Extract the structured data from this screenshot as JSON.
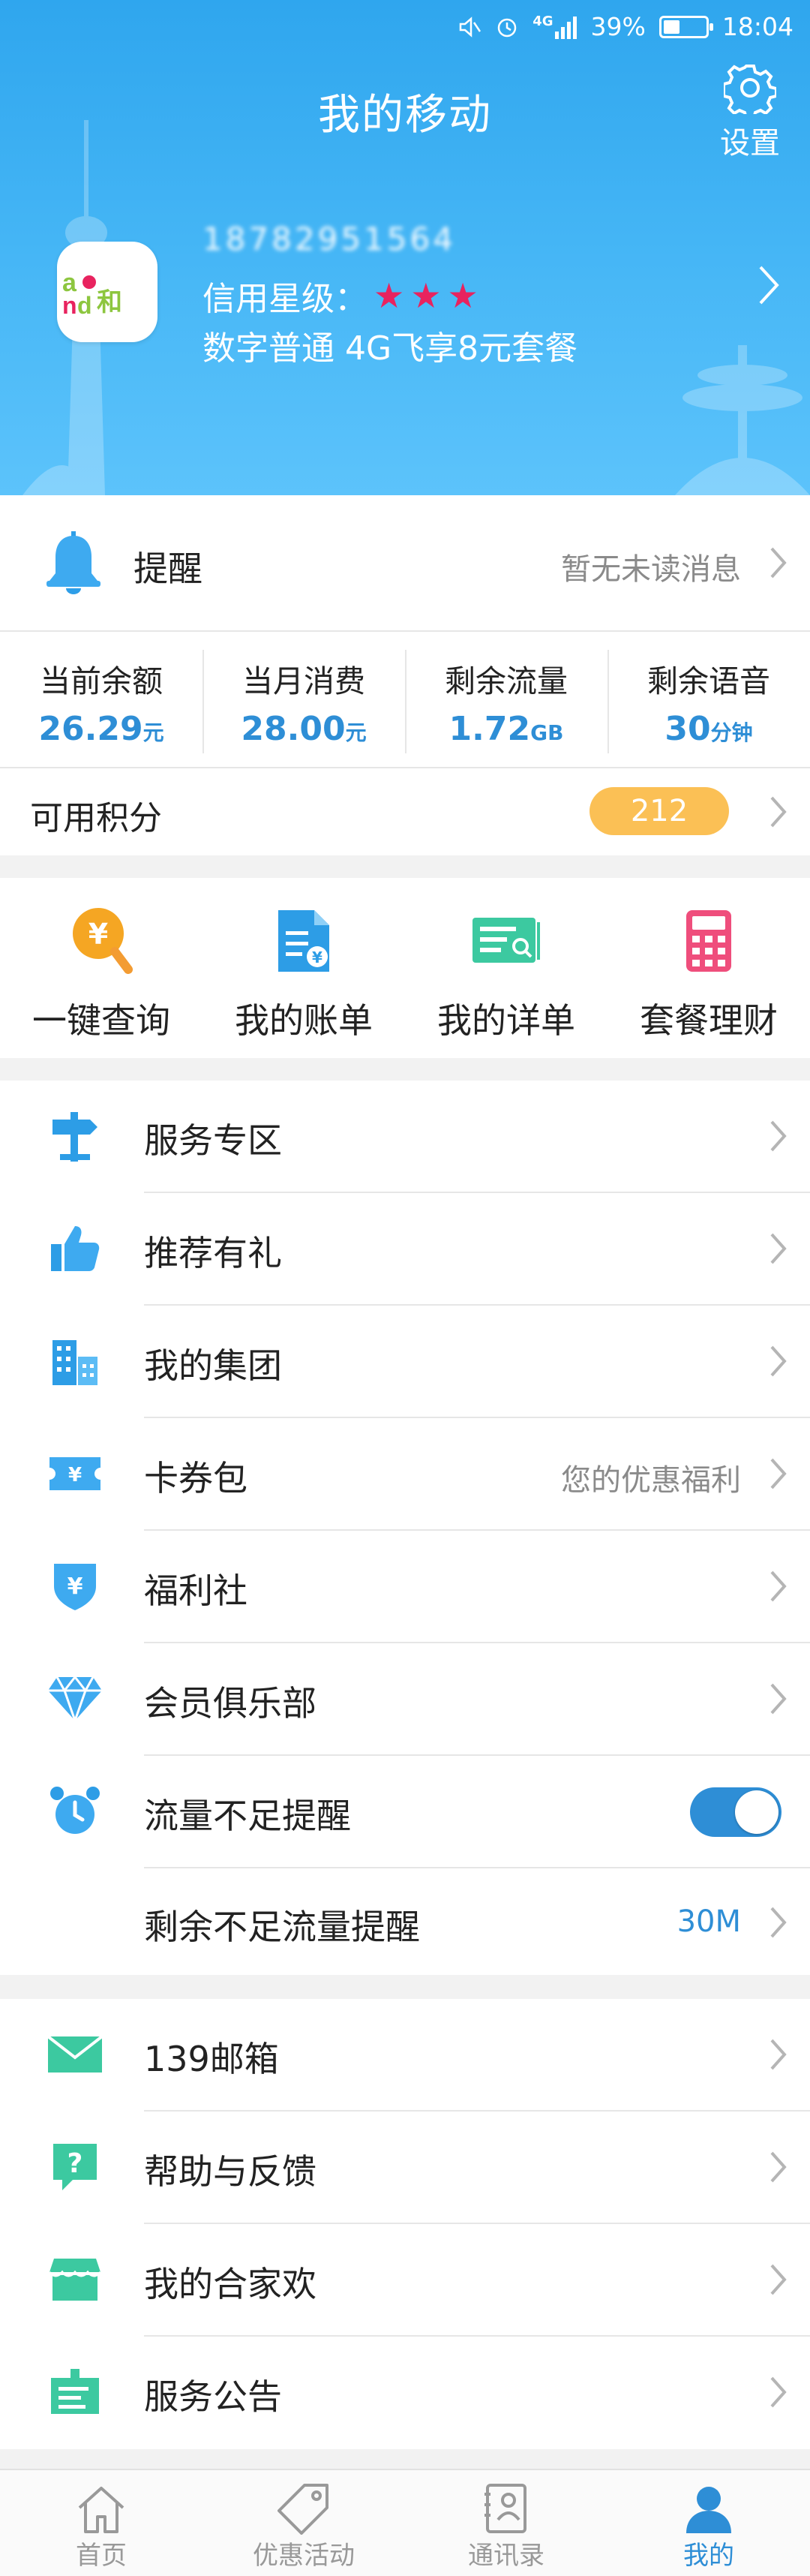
{
  "status_bar": {
    "battery": "39%",
    "time": "18:04",
    "network": "4G",
    "battery_level": 0.39
  },
  "header": {
    "title": "我的移动",
    "settings_label": "设置"
  },
  "profile": {
    "phone": "18782951564",
    "credit_label": "信用星级：",
    "credit_stars": 3,
    "star_glyph": "★",
    "plan": "数字普通  4G飞享8元套餐",
    "logo_text": "and和"
  },
  "reminder": {
    "label": "提醒",
    "status": "暂无未读消息"
  },
  "stats": [
    {
      "label": "当前余额",
      "value": "26.29",
      "unit": "元"
    },
    {
      "label": "当月消费",
      "value": "28.00",
      "unit": "元"
    },
    {
      "label": "剩余流量",
      "value": "1.72",
      "unit": "GB"
    },
    {
      "label": "剩余语音",
      "value": "30",
      "unit": "分钟"
    }
  ],
  "points": {
    "label": "可用积分",
    "value": "212"
  },
  "quick": [
    {
      "label": "一键查询",
      "icon": "coin-search-icon"
    },
    {
      "label": "我的账单",
      "icon": "bill-icon"
    },
    {
      "label": "我的详单",
      "icon": "detail-list-icon"
    },
    {
      "label": "套餐理财",
      "icon": "calculator-icon"
    }
  ],
  "menu1": [
    {
      "label": "服务专区",
      "sub": "",
      "icon": "signpost-icon"
    },
    {
      "label": "推荐有礼",
      "sub": "",
      "icon": "thumbs-up-icon"
    },
    {
      "label": "我的集团",
      "sub": "",
      "icon": "building-icon"
    },
    {
      "label": "卡券包",
      "sub": "您的优惠福利",
      "icon": "ticket-icon"
    },
    {
      "label": "福利社",
      "sub": "",
      "icon": "welfare-shield-icon"
    },
    {
      "label": "会员俱乐部",
      "sub": "",
      "icon": "diamond-icon"
    },
    {
      "label": "流量不足提醒",
      "sub": "",
      "icon": "alarm-clock-icon",
      "toggle": true
    },
    {
      "label": "剩余不足流量提醒",
      "sub": "30M",
      "icon": ""
    }
  ],
  "menu2": [
    {
      "label": "139邮箱",
      "icon": "mail-icon"
    },
    {
      "label": "帮助与反馈",
      "icon": "help-icon"
    },
    {
      "label": "我的合家欢",
      "icon": "family-shop-icon"
    },
    {
      "label": "服务公告",
      "icon": "notice-icon"
    }
  ],
  "tabs": [
    {
      "label": "首页",
      "icon": "home-icon"
    },
    {
      "label": "优惠活动",
      "icon": "tag-icon"
    },
    {
      "label": "通讯录",
      "icon": "contacts-icon"
    },
    {
      "label": "我的",
      "icon": "person-icon",
      "active": true
    }
  ],
  "colors": {
    "accent": "#2e8ed6",
    "header": "#3aaef2",
    "star": "#e8235f",
    "badge": "#fbc055"
  }
}
